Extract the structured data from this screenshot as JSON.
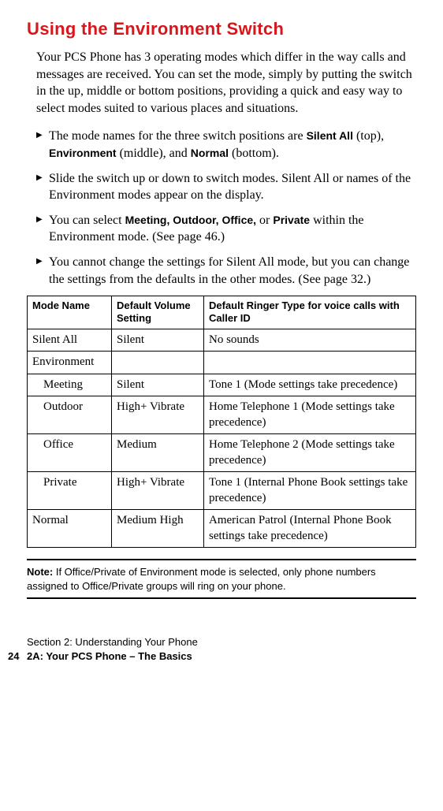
{
  "heading": "Using the Environment Switch",
  "intro": "Your PCS Phone has 3 operating modes which differ in the way calls and messages are received. You can set the mode, simply by putting the switch in the up, middle or bottom positions, providing a quick and easy way to select modes suited to various places and situations.",
  "bullets": [
    {
      "pre": "The mode names for the three switch positions are ",
      "bold1": "Silent All",
      "mid1": " (top), ",
      "bold2": "Environment",
      "mid2": " (middle), and ",
      "bold3": "Normal",
      "post": " (bottom)."
    },
    {
      "pre": "Slide the switch up or down to switch modes. Silent All or names of the Environment modes appear on the display.",
      "bold1": "",
      "mid1": "",
      "bold2": "",
      "mid2": "",
      "bold3": "",
      "post": ""
    },
    {
      "pre": "You can select ",
      "bold1": "Meeting, Outdoor, Office,",
      "mid1": " or ",
      "bold2": "Private",
      "mid2": " within the Environment mode. (See page 46.)",
      "bold3": "",
      "post": ""
    },
    {
      "pre": "You cannot change the settings for Silent All mode, but you can change the settings from the defaults in the other modes. (See page 32.)",
      "bold1": "",
      "mid1": "",
      "bold2": "",
      "mid2": "",
      "bold3": "",
      "post": ""
    }
  ],
  "table": {
    "headers": {
      "mode": "Mode Name",
      "volume": "Default Volume Setting",
      "ringer": "Default Ringer Type for voice calls with Caller ID"
    },
    "rows": [
      {
        "mode": "Silent All",
        "indent": false,
        "volume": "Silent",
        "ringer": "No sounds"
      },
      {
        "mode": "Environment",
        "indent": false,
        "volume": "",
        "ringer": ""
      },
      {
        "mode": "Meeting",
        "indent": true,
        "volume": "Silent",
        "ringer": "Tone 1 (Mode settings take precedence)"
      },
      {
        "mode": "Outdoor",
        "indent": true,
        "volume": "High+ Vibrate",
        "ringer": "Home Telephone 1 (Mode settings take precedence)"
      },
      {
        "mode": "Office",
        "indent": true,
        "volume": "Medium",
        "ringer": "Home Telephone 2 (Mode settings take precedence)"
      },
      {
        "mode": "Private",
        "indent": true,
        "volume": "High+ Vibrate",
        "ringer": "Tone 1 (Internal Phone Book settings take precedence)"
      },
      {
        "mode": "Normal",
        "indent": false,
        "volume": "Medium High",
        "ringer": "American Patrol (Internal Phone Book settings take precedence)"
      }
    ]
  },
  "note": {
    "label": "Note:",
    "text": " If Office/Private of Environment mode is selected, only phone numbers assigned to Office/Private groups will ring on your phone."
  },
  "footer": {
    "section": "Section 2: Understanding Your Phone",
    "page_number": "24",
    "chapter": "2A: Your PCS Phone – The Basics"
  }
}
